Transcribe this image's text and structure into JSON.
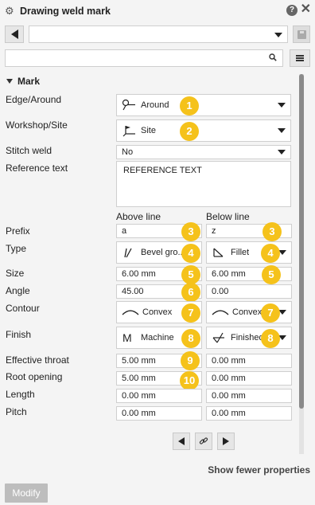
{
  "window": {
    "title": "Drawing weld mark",
    "help_glyph": "?",
    "close_glyph": "✕"
  },
  "toolbar": {
    "preset_value": "",
    "search_placeholder": ""
  },
  "section": {
    "title": "Mark"
  },
  "labels": {
    "edge_around": "Edge/Around",
    "workshop_site": "Workshop/Site",
    "stitch_weld": "Stitch weld",
    "reference_text": "Reference text",
    "prefix": "Prefix",
    "type": "Type",
    "size": "Size",
    "angle": "Angle",
    "contour": "Contour",
    "finish": "Finish",
    "effective_throat": "Effective throat",
    "root_opening": "Root opening",
    "length": "Length",
    "pitch": "Pitch"
  },
  "columns": {
    "above": "Above line",
    "below": "Below line"
  },
  "values": {
    "edge_around": "Around",
    "workshop_site": "Site",
    "stitch_weld": "No",
    "reference_text": "REFERENCE TEXT",
    "above": {
      "prefix": "a",
      "type": "Bevel gro...",
      "size": "6.00 mm",
      "angle": "45.00",
      "contour": "Convex",
      "finish": "Machine",
      "effective_throat": "5.00 mm",
      "root_opening": "5.00 mm",
      "length": "0.00 mm",
      "pitch": "0.00 mm"
    },
    "below": {
      "prefix": "z",
      "type": "Fillet",
      "size": "6.00 mm",
      "angle": "0.00",
      "contour": "Convex",
      "finish": "Finished",
      "effective_throat": "0.00 mm",
      "root_opening": "0.00 mm",
      "length": "0.00 mm",
      "pitch": "0.00 mm"
    }
  },
  "badges": {
    "b1": "1",
    "b2": "2",
    "b3": "3",
    "b4": "4",
    "b5": "5",
    "b6": "6",
    "b7": "7",
    "b8": "8",
    "b9": "9",
    "b10": "10"
  },
  "footer": {
    "show_fewer": "Show fewer properties",
    "modify": "Modify"
  },
  "colors": {
    "badge": "#f5c21b",
    "disabled_button": "#bdbdbd"
  },
  "icons": {
    "edge_around": "around-weld-icon",
    "workshop_site": "site-flag-icon",
    "type_above": "bevel-groove-icon",
    "type_below": "fillet-icon",
    "contour": "convex-contour-icon",
    "finish_above": "machine-finish-icon",
    "finish_below": "finished-icon",
    "link": "link-icon"
  }
}
